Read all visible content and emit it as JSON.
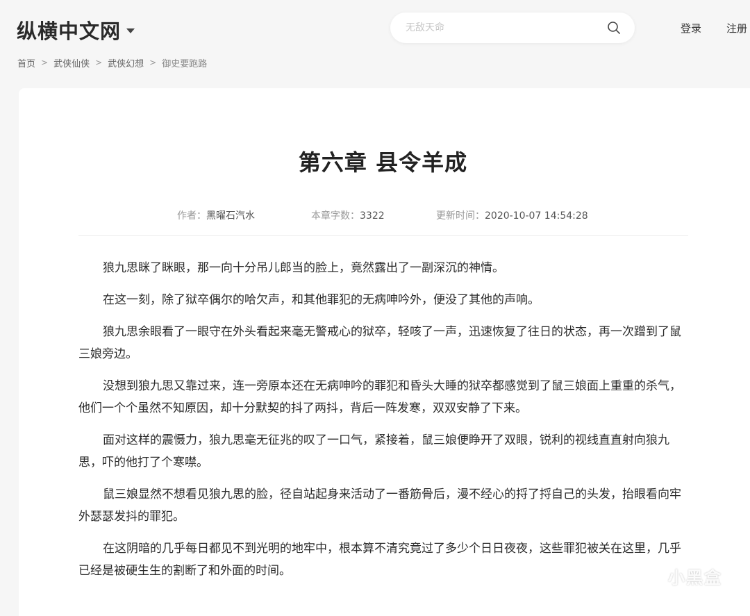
{
  "header": {
    "logo": "纵横中文网",
    "search_placeholder": "无敌天命",
    "login": "登录",
    "register": "注册"
  },
  "breadcrumb": [
    {
      "label": "首页"
    },
    {
      "label": "武侠仙侠"
    },
    {
      "label": "武侠幻想"
    },
    {
      "label": "御史要跑路"
    }
  ],
  "chapter": {
    "title": "第六章 县令羊成",
    "author_label": "作者：",
    "author": "黑曜石汽水",
    "words_label": "本章字数：",
    "words": "3322",
    "updated_label": "更新时间：",
    "updated": "2020-10-07 14:54:28"
  },
  "paragraphs": [
    "狼九思眯了眯眼，那一向十分吊儿郎当的脸上，竟然露出了一副深沉的神情。",
    "在这一刻，除了狱卒偶尔的哈欠声，和其他罪犯的无病呻吟外，便没了其他的声响。",
    "狼九思余眼看了一眼守在外头看起来毫无警戒心的狱卒，轻咳了一声，迅速恢复了往日的状态，再一次蹭到了鼠三娘旁边。",
    "没想到狼九思又靠过来，连一旁原本还在无病呻吟的罪犯和昏头大睡的狱卒都感觉到了鼠三娘面上重重的杀气，他们一个个虽然不知原因，却十分默契的抖了两抖，背后一阵发寒，双双安静了下来。",
    "面对这样的震慑力，狼九思毫无征兆的叹了一口气，紧接着，鼠三娘便睁开了双眼，锐利的视线直直射向狼九思，吓的他打了个寒噤。",
    "鼠三娘显然不想看见狼九思的脸，径自站起身来活动了一番筋骨后，漫不经心的捋了捋自己的头发，抬眼看向牢外瑟瑟发抖的罪犯。",
    "在这阴暗的几乎每日都见不到光明的地牢中，根本算不清究竟过了多少个日日夜夜，这些罪犯被关在这里，几乎已经是被硬生生的割断了和外面的时间。"
  ],
  "watermark": "小黑盒"
}
